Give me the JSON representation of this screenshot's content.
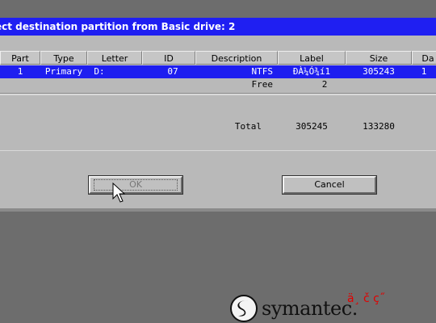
{
  "dialog": {
    "title": "ect destination partition from Basic drive: 2",
    "columns": [
      "Part",
      "Type",
      "Letter",
      "ID",
      "Description",
      "Label",
      "Size",
      "Da"
    ],
    "rows": [
      {
        "part": "1",
        "type": "Primary",
        "letter": "D:",
        "id": "07",
        "description": "NTFS",
        "label": "ÐÀ¼Ó¾í1",
        "size": "305243",
        "da": "1"
      },
      {
        "part": "",
        "type": "",
        "letter": "",
        "id": "",
        "description": "Free",
        "label": "2",
        "size": "",
        "da": ""
      }
    ],
    "total": {
      "description": "Total",
      "label": "305245",
      "size": "133280"
    },
    "ok_label": "OK",
    "cancel_label": "Cancel"
  },
  "brand": {
    "name": "symantec.",
    "garbled_text": "ä¸ č  ç˝"
  },
  "colors": {
    "titlebar": "#1f1ff2",
    "selection": "#1e1ef0",
    "dialog": "#b9b9b9",
    "background": "#6d6d6d"
  }
}
